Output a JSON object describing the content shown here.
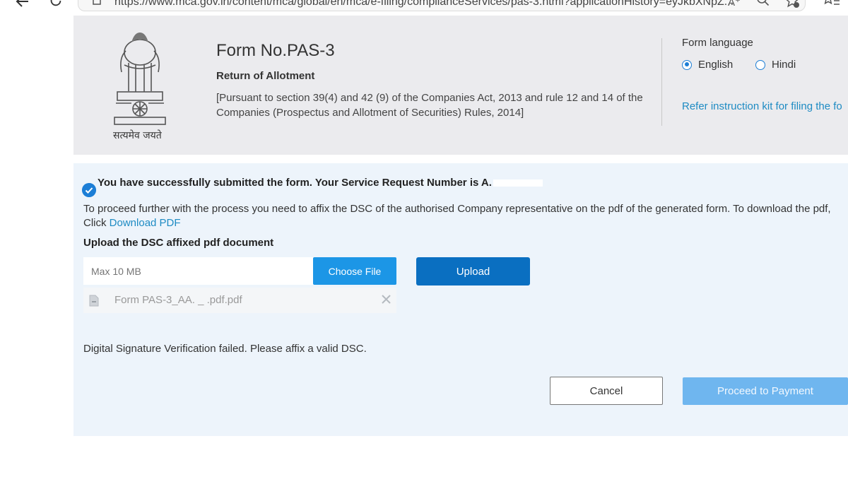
{
  "browser": {
    "url": "https://www.mca.gov.in/content/mca/global/en/mca/e-filing/complianceServices/pas-3.html?applicationHistory=eyJkbXNpZ...",
    "read_aloud": "A⁺"
  },
  "header": {
    "emblem_caption": "सत्यमेव जयते",
    "form_title": "Form No.PAS-3",
    "form_subtitle": "Return of Allotment",
    "form_description": "[Pursuant to section 39(4) and 42 (9) of the Companies Act, 2013 and rule 12 and 14 of the Companies (Prospectus and Allotment of Securities) Rules, 2014]",
    "language_title": "Form language",
    "language_options": [
      "English",
      "Hindi"
    ],
    "selected_language": "English",
    "instruction_link": "Refer instruction kit for filing the fo"
  },
  "panel": {
    "success_message": "You have successfully submitted the form. Your Service Request Number is A.",
    "proceed_text": "To proceed further with the process you need to affix the DSC of the authorised Company representative on the pdf of the generated form. To download the pdf, Click",
    "download_link": "Download PDF",
    "upload_label": "Upload the DSC affixed pdf document",
    "file_input_placeholder": "Max 10 MB",
    "choose_file_label": "Choose File",
    "upload_label_btn": "Upload",
    "uploaded_file_name": "Form PAS-3_AA.          _        .pdf.pdf",
    "dsc_error": "Digital Signature Verification failed. Please affix a valid DSC.",
    "cancel_label": "Cancel",
    "proceed_payment_label": "Proceed to Payment"
  },
  "colors": {
    "primary": "#1c96e6",
    "primary_dark": "#0a6fc1",
    "disabled": "#6fb6ef",
    "link": "#1e8bc3",
    "panel_bg": "#edf4fb",
    "header_bg": "#ebebee"
  }
}
